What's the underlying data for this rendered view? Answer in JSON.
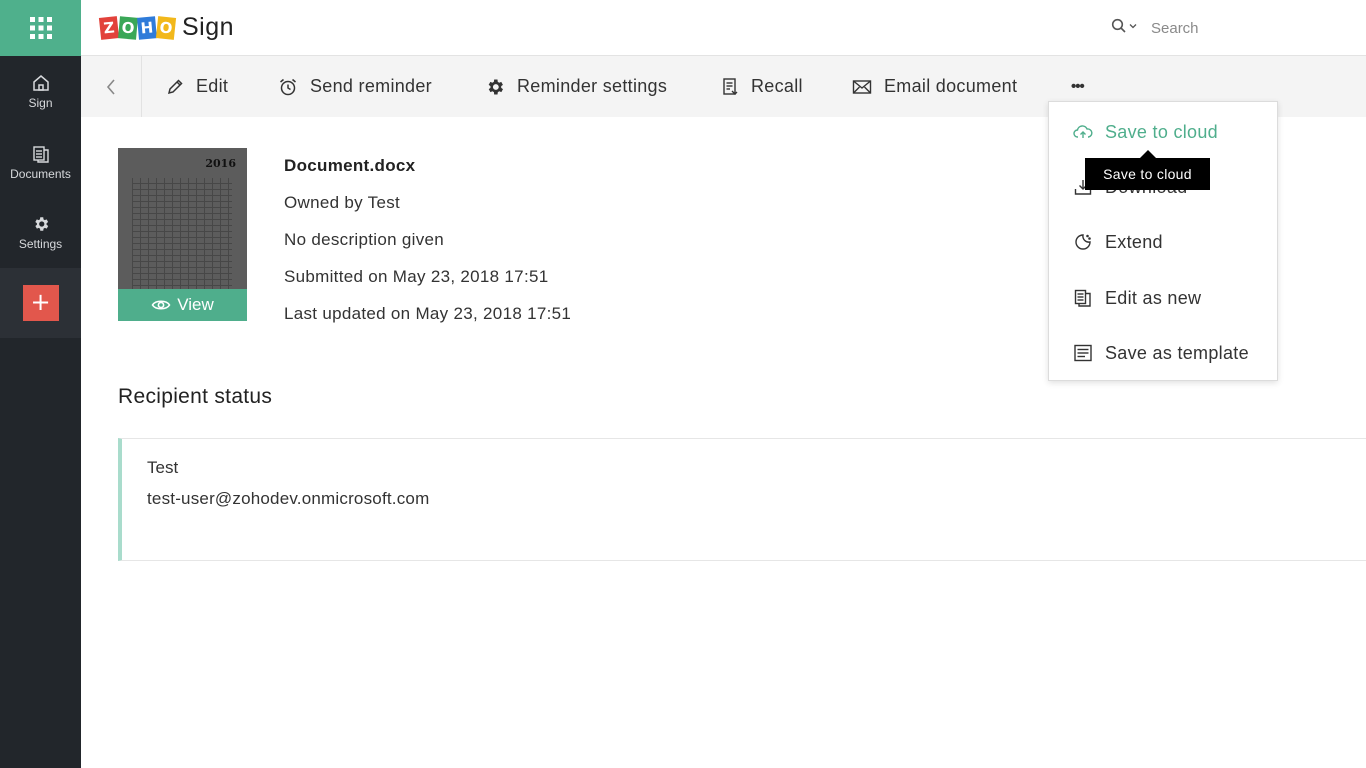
{
  "sidebar": {
    "items": [
      {
        "label": "Sign",
        "icon": "home-icon"
      },
      {
        "label": "Documents",
        "icon": "documents-icon"
      },
      {
        "label": "Settings",
        "icon": "gear-icon"
      }
    ],
    "add_label": "+"
  },
  "header": {
    "logo_letters": [
      "Z",
      "O",
      "H",
      "O"
    ],
    "app_name": "Sign",
    "search_placeholder": "Search"
  },
  "toolbar": {
    "edit": "Edit",
    "send_reminder": "Send reminder",
    "reminder_settings": "Reminder settings",
    "recall": "Recall",
    "email_document": "Email document",
    "more": "•••"
  },
  "document": {
    "thumbnail_year": "2016",
    "view_label": "View",
    "name": "Document.docx",
    "owner": "Owned by Test",
    "description": "No description given",
    "submitted": "Submitted on May 23, 2018 17:51",
    "updated": "Last updated on May 23, 2018 17:51"
  },
  "recipients": {
    "title": "Recipient status",
    "items": [
      {
        "name": "Test",
        "email": "test-user@zohodev.onmicrosoft.com"
      }
    ]
  },
  "menu": {
    "items": [
      {
        "label": "Save to cloud",
        "icon": "cloud-upload-icon"
      },
      {
        "label": "Download",
        "icon": "download-icon"
      },
      {
        "label": "Extend",
        "icon": "extend-clock-icon"
      },
      {
        "label": "Edit as new",
        "icon": "edit-as-new-icon"
      },
      {
        "label": "Save as template",
        "icon": "template-icon"
      }
    ],
    "tooltip": "Save to cloud"
  },
  "colors": {
    "accent": "#4fae8c",
    "sidebar_bg": "#22262b",
    "add_button": "#e2574c"
  }
}
